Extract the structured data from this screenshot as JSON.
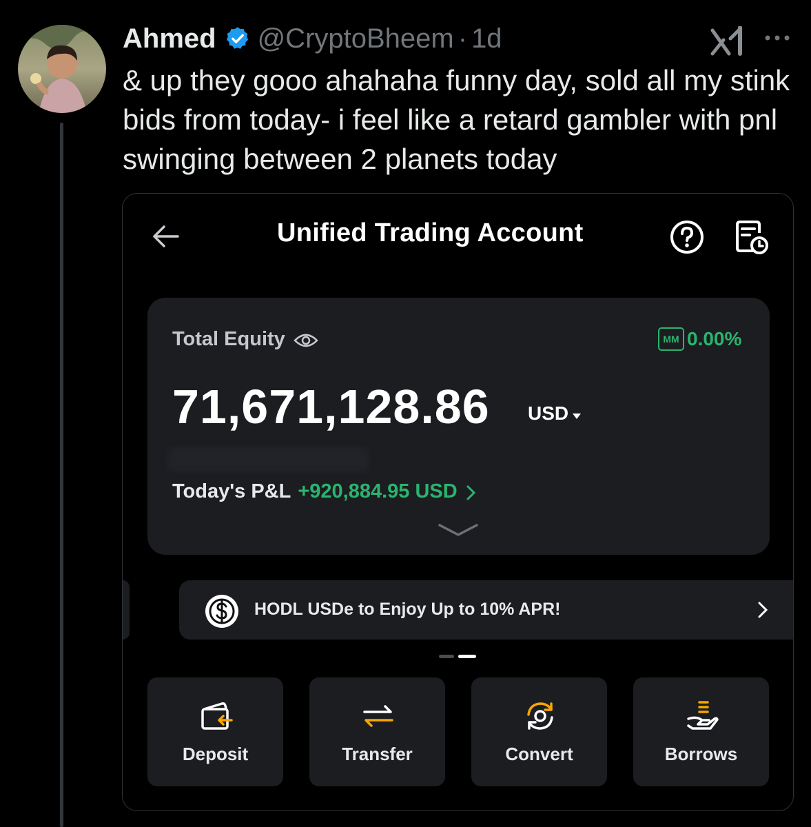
{
  "tweet": {
    "display_name": "Ahmed",
    "handle": "@CryptoBheem",
    "separator": "·",
    "time": "1d",
    "text": "& up they gooo ahahaha funny day, sold all my stink bids from today- i feel like a retard gambler with pnl swinging between 2 planets today",
    "icons": [
      "verified-icon",
      "grok-icon",
      "more-icon"
    ]
  },
  "app": {
    "title": "Unified Trading Account",
    "icons": [
      "back-arrow-icon",
      "help-icon",
      "history-icon"
    ],
    "equity": {
      "label": "Total Equity",
      "mm_badge": "MM",
      "mm_value": "0.00%",
      "value": "71,671,128.86",
      "currency": "USD",
      "pnl_label": "Today's P&L",
      "pnl_value": "+920,884.95 USD"
    },
    "promo": {
      "text": "HODL USDe to Enjoy Up to 10% APR!"
    },
    "actions": [
      {
        "label": "Deposit"
      },
      {
        "label": "Transfer"
      },
      {
        "label": "Convert"
      },
      {
        "label": "Borrows"
      }
    ],
    "colors": {
      "accent_green": "#2ab46f",
      "accent_orange": "#f7a600",
      "card_bg": "#1c1d21"
    }
  }
}
